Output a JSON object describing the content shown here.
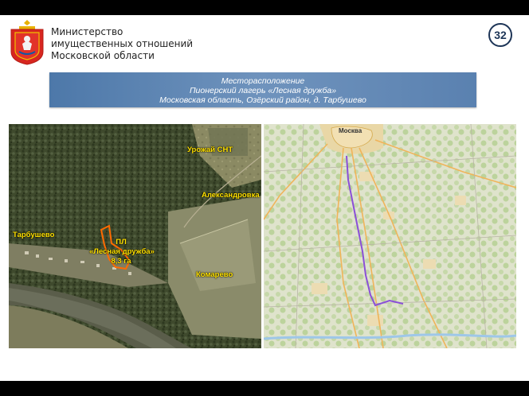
{
  "header": {
    "ministry_lines": [
      "Министерство",
      "имущественных отношений",
      "Московской области"
    ],
    "page_number": "32"
  },
  "banner": {
    "lines": [
      "Месторасположение",
      "Пионерский лагерь «Лесная дружба»",
      "Московская область, Озёрский район, д. Тарбушево"
    ]
  },
  "satellite_map": {
    "labels": {
      "urozhai": "Урожай СНТ",
      "aleksandrovka": "Александровка",
      "tarbushevo": "Тарбушево",
      "camp_line1": "ПЛ",
      "camp_line2": "«Лесная дружба»",
      "camp_line3": "8,3 га",
      "komarevo": "Комарево"
    },
    "label_color": "#ffe100",
    "plot_outline_color": "#ff6a00"
  },
  "road_map": {
    "city_label": "Москва",
    "route_color": "#8a4fd8"
  },
  "colors": {
    "banner": "#5a81b0",
    "page_number": "#1d3557"
  }
}
